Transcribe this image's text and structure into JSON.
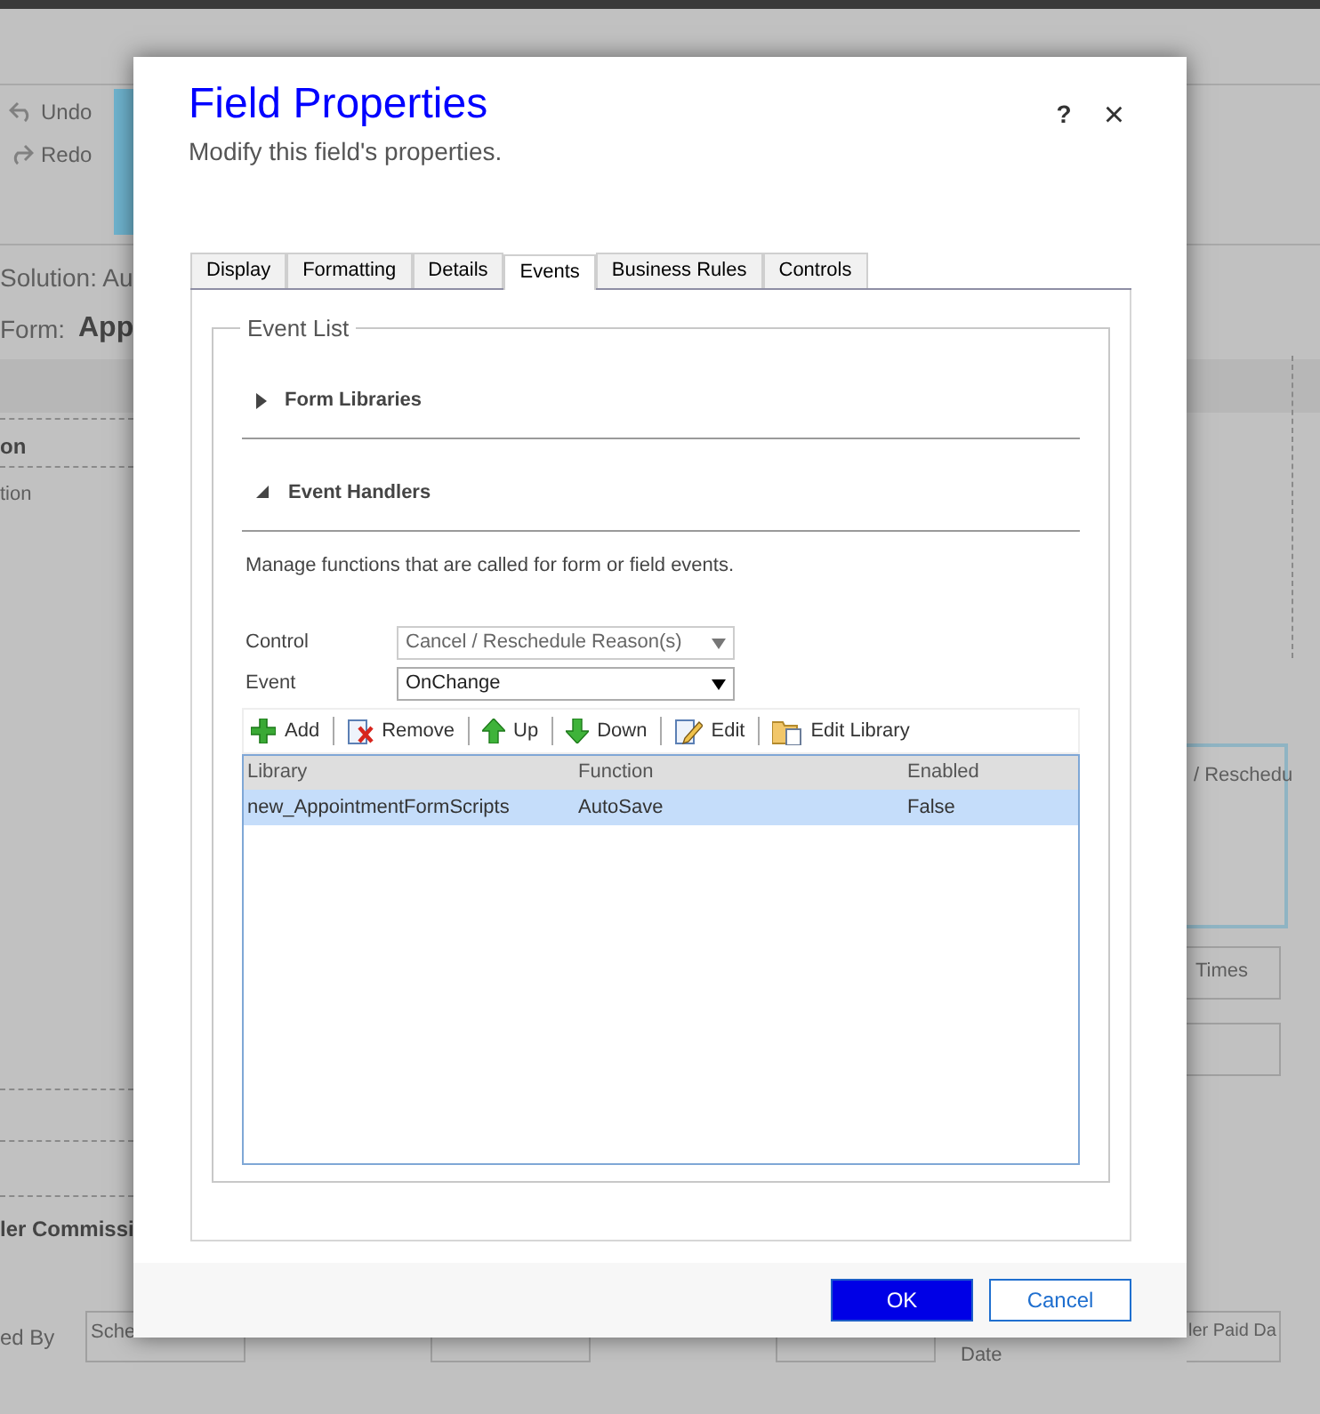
{
  "background": {
    "undo": "Undo",
    "redo": "Redo",
    "solution": "Solution: Au",
    "form_label": "Form:",
    "form_name": "App",
    "section_header": "on",
    "field_hint": "tion",
    "field_text_1": "/ Reschedu",
    "field_text_2": "Times",
    "section_title": "ler Commissi",
    "label_1": "ed By",
    "field_hint_2": "Sche",
    "label_2": "Date",
    "field_hint_3": "ler Paid Da"
  },
  "dialog": {
    "title": "Field Properties",
    "subtitle": "Modify this field's properties.",
    "help": "?",
    "close": "×",
    "tabs": [
      {
        "label": "Display",
        "selected": false
      },
      {
        "label": "Formatting",
        "selected": false
      },
      {
        "label": "Details",
        "selected": false
      },
      {
        "label": "Events",
        "selected": true
      },
      {
        "label": "Business Rules",
        "selected": false
      },
      {
        "label": "Controls",
        "selected": false
      }
    ],
    "event_list": {
      "legend": "Event List",
      "sections": [
        {
          "label": "Form Libraries",
          "expanded": false
        },
        {
          "label": "Event Handlers",
          "expanded": true
        }
      ],
      "description": "Manage functions that are called for form or field events.",
      "fields": [
        {
          "label": "Control",
          "value": "Cancel / Reschedule Reason(s)",
          "disabled": true
        },
        {
          "label": "Event",
          "value": "OnChange",
          "disabled": false
        }
      ],
      "toolbar": [
        {
          "label": "Add",
          "kind": "add"
        },
        {
          "label": "Remove",
          "kind": "remove"
        },
        {
          "label": "Up",
          "kind": "up"
        },
        {
          "label": "Down",
          "kind": "down"
        },
        {
          "label": "Edit",
          "kind": "edit"
        },
        {
          "label": "Edit Library",
          "kind": "library"
        }
      ],
      "table": {
        "columns": [
          "Library",
          "Function",
          "Enabled"
        ],
        "rows": [
          {
            "cells": [
              "new_AppointmentFormScripts",
              "AutoSave",
              "False"
            ],
            "selected": true
          }
        ]
      }
    },
    "buttons": [
      {
        "label": "OK",
        "kind": "primary"
      },
      {
        "label": "Cancel",
        "kind": "secondary"
      }
    ]
  }
}
